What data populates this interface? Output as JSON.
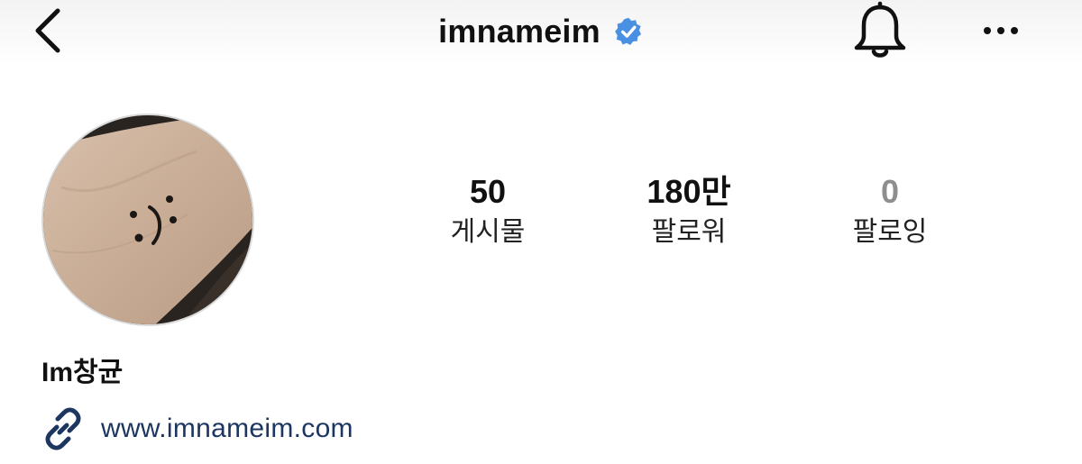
{
  "header": {
    "username": "imnameim",
    "icons": {
      "back": "chevron-left-icon",
      "verified": "verified-badge-icon",
      "notifications": "bell-icon",
      "more": "more-dots-icon"
    }
  },
  "profile": {
    "avatar_icon": "profile-photo",
    "display_name": "Im창균",
    "link": {
      "text": "www.imnameim.com",
      "icon": "link-icon"
    }
  },
  "stats": [
    {
      "value": "50",
      "label": "게시물"
    },
    {
      "value": "180만",
      "label": "팔로워"
    },
    {
      "value": "0",
      "label": "팔로잉"
    }
  ],
  "colors": {
    "verified_blue": "#4a90e2",
    "link_blue": "#1d3660",
    "muted_gray": "#8e8e8e",
    "text": "#111111"
  }
}
